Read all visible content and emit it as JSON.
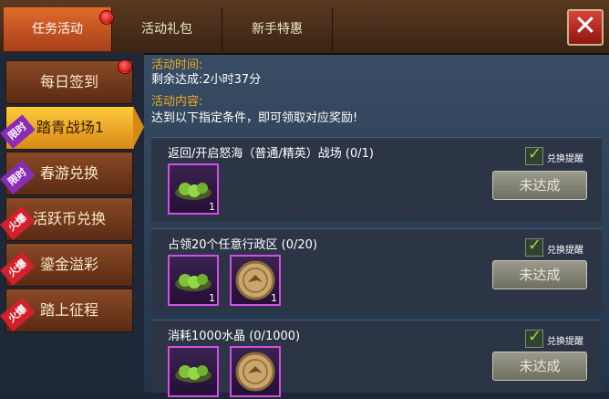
{
  "tabs": [
    {
      "label": "任务活动",
      "active": true,
      "badge": true
    },
    {
      "label": "活动礼包",
      "active": false,
      "badge": false
    },
    {
      "label": "新手特惠",
      "active": false,
      "badge": false
    }
  ],
  "close_label": "✕",
  "menu": [
    {
      "label": "每日签到",
      "badge": true,
      "tag": ""
    },
    {
      "label": "踏青战场1",
      "active": true,
      "tag": "限时",
      "tag_color": "purple"
    },
    {
      "label": "春游兑换",
      "tag": "限时",
      "tag_color": "purple"
    },
    {
      "label": "活跃币兑换",
      "tag": "火爆",
      "tag_color": "red"
    },
    {
      "label": "鎏金溢彩",
      "tag": "火爆",
      "tag_color": "red"
    },
    {
      "label": "踏上征程",
      "tag": "火爆",
      "tag_color": "red"
    }
  ],
  "info": {
    "time_label": "活动时间:",
    "time_value": "剩余达成:2小时37分",
    "content_label": "活动内容:",
    "content_value": "达到以下指定条件，即可领取对应奖励!"
  },
  "tasks": [
    {
      "title": "返回/开启怒海（普通/精英）战场 (0/1)",
      "rewards": [
        {
          "icon": "green-dumpling-icon",
          "count": "1"
        }
      ],
      "check_label": "兑换提醒",
      "button": "未达成"
    },
    {
      "title": "占领20个任意行政区 (0/20)",
      "rewards": [
        {
          "icon": "green-dumpling-icon",
          "count": "1"
        },
        {
          "icon": "gold-coin-icon",
          "count": "1"
        }
      ],
      "check_label": "兑换提醒",
      "button": "未达成"
    },
    {
      "title": "消耗1000水晶 (0/1000)",
      "rewards": [
        {
          "icon": "green-dumpling-icon",
          "count": ""
        },
        {
          "icon": "gold-coin-icon",
          "count": ""
        }
      ],
      "check_label": "兑换提醒",
      "button": "未达成"
    }
  ]
}
